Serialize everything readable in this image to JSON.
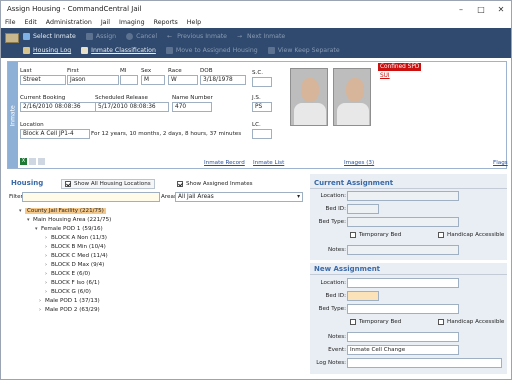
{
  "window": {
    "title": "Assign Housing - CommandCentral Jail"
  },
  "menu": [
    "File",
    "Edit",
    "Administration",
    "Jail",
    "Imaging",
    "Reports",
    "Help"
  ],
  "toolbar": {
    "row1": [
      {
        "label": "Select Inmate",
        "enabled": true
      },
      {
        "label": "Assign",
        "enabled": false
      },
      {
        "label": "Cancel",
        "enabled": false
      },
      {
        "label": "Previous Inmate",
        "enabled": false
      },
      {
        "label": "Next Inmate",
        "enabled": false
      }
    ],
    "row2": [
      {
        "label": "Housing Log",
        "enabled": true
      },
      {
        "label": "Inmate Classification",
        "enabled": true
      },
      {
        "label": "Move to Assigned Housing",
        "enabled": false
      },
      {
        "label": "View Keep Separate",
        "enabled": false
      }
    ]
  },
  "inmate": {
    "tab_label": "Inmate",
    "labels": {
      "last": "Last",
      "first": "First",
      "mi": "MI",
      "sex": "Sex",
      "race": "Race",
      "dob": "DOB",
      "current_booking": "Current Booking",
      "scheduled_release": "Scheduled Release",
      "name_number": "Name Number",
      "location": "Location",
      "sc": "S.C.",
      "js": "J.S.",
      "lc": "LC."
    },
    "values": {
      "last": "Street",
      "first": "Jason",
      "mi": "",
      "sex": "M",
      "race": "W",
      "dob": "3/18/1978",
      "current_booking": "2/16/2010 08:08:36",
      "scheduled_release": "5/17/2010 08:08:36",
      "name_number": "470",
      "location": "Block A Cell JP1-4",
      "duration": "For 12 years, 10 months, 2 days, 8 hours, 37 minutes",
      "sc": "",
      "js": "PS",
      "lc": ""
    },
    "links": {
      "inmate_record": "Inmate Record",
      "inmate_list": "Inmate List",
      "images": "Images (3)",
      "flags": "Flags"
    },
    "flags": {
      "badge": "Confined SPD",
      "sub": "SUI"
    }
  },
  "housing": {
    "title": "Housing",
    "show_all_label": "Show All Housing Locations",
    "show_all_checked": true,
    "show_assigned_label": "Show Assigned Inmates",
    "show_assigned_checked": true,
    "filter_label": "Filter",
    "filter_value": "",
    "areas_label": "Areas:",
    "areas_value": "All Jail Areas",
    "tree": [
      {
        "label": "County Jail Facility (221/75)",
        "level": 0,
        "selected": true
      },
      {
        "label": "Main Housing Area (221/75)",
        "level": 1
      },
      {
        "label": "Female POD 1 (59/16)",
        "level": 2
      },
      {
        "label": "BLOCK A Non (11/3)",
        "level": 3
      },
      {
        "label": "BLOCK B Min (10/4)",
        "level": 3
      },
      {
        "label": "BLOCK C Med (11/4)",
        "level": 3
      },
      {
        "label": "BLOCK D Max (9/4)",
        "level": 3
      },
      {
        "label": "BLOCK E (6/0)",
        "level": 3
      },
      {
        "label": "BLOCK F Iso (6/1)",
        "level": 3
      },
      {
        "label": "BLOCK G (6/0)",
        "level": 3
      },
      {
        "label": "Male POD 1 (37/13)",
        "level": 2
      },
      {
        "label": "Male POD 2 (63/29)",
        "level": 2
      }
    ]
  },
  "current_assignment": {
    "title": "Current Assignment",
    "location_label": "Location:",
    "bed_id_label": "Bed ID:",
    "bed_type_label": "Bed Type:",
    "temporary_bed": "Temporary Bed",
    "handicap": "Handicap Accessible",
    "notes_label": "Notes:"
  },
  "new_assignment": {
    "title": "New Assignment",
    "location_label": "Location:",
    "bed_id_label": "Bed ID:",
    "bed_type_label": "Bed Type:",
    "temporary_bed": "Temporary Bed",
    "handicap": "Handicap Accessible",
    "notes_label": "Notes:",
    "event_label": "Event:",
    "event_value": "Inmate Cell Change",
    "log_notes_label": "Log Notes:"
  },
  "colors": {
    "toolbar": "#2f4a6e",
    "accent": "#3a6aa8",
    "flag": "#cc1010",
    "selected": "#f4c88a"
  }
}
